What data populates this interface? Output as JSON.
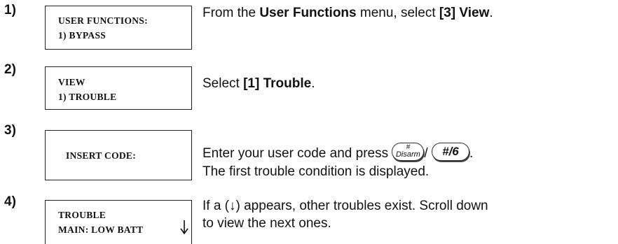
{
  "steps": [
    {
      "number": "1)",
      "display": [
        "USER FUNCTIONS:",
        "1) BYPASS"
      ],
      "instruction": {
        "prefix": "From the ",
        "bold1": "User Functions",
        "middle": " menu, select ",
        "bold2": "[3] View",
        "suffix": "."
      }
    },
    {
      "number": "2)",
      "display": [
        "VIEW",
        "1) TROUBLE"
      ],
      "instruction": {
        "prefix": "Select ",
        "bold1": "[1] Trouble",
        "suffix": "."
      }
    },
    {
      "number": "3)",
      "display": [
        "INSERT CODE:"
      ],
      "instruction": {
        "prefix": "Enter your user code and press ",
        "separator": "/ ",
        "suffix": ".",
        "line2": "The first trouble condition is displayed."
      },
      "keys": {
        "disarm_symbol": "#",
        "disarm_label": "Disarm",
        "hash_label": "#/6"
      }
    },
    {
      "number": "4)",
      "display": [
        "TROUBLE",
        "MAIN: LOW BATT"
      ],
      "scroll_icon": "down-arrow-icon",
      "instruction": {
        "line1": "If a (↓) appears, other troubles exist. Scroll down",
        "line2": "to view the next ones."
      }
    }
  ]
}
